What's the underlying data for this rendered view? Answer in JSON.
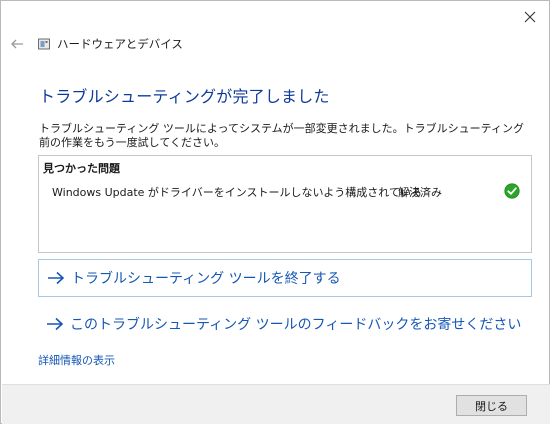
{
  "window": {
    "nav_title": "ハードウェアとデバイス",
    "close_glyph": "×"
  },
  "main": {
    "heading": "トラブルシューティングが完了しました",
    "description": "トラブルシューティング ツールによってシステムが一部変更されました。トラブルシューティング前の作業をもう一度試してください。"
  },
  "problems": {
    "header": "見つかった問題",
    "items": [
      {
        "name": "Windows Update がドライバーをインストールしないよう構成されている",
        "status": "解決済み",
        "status_icon": "check-circle-icon"
      }
    ]
  },
  "actions": {
    "exit_troubleshooter": "トラブルシューティング ツールを終了する",
    "send_feedback": "このトラブルシューティング ツールのフィードバックをお寄せください",
    "view_details": "詳細情報の表示"
  },
  "footer": {
    "close_button": "閉じる"
  },
  "colors": {
    "heading": "#0e3a9b",
    "link": "#1557b5",
    "success": "#2aa52a",
    "footer_bg": "#f0f0f0"
  }
}
